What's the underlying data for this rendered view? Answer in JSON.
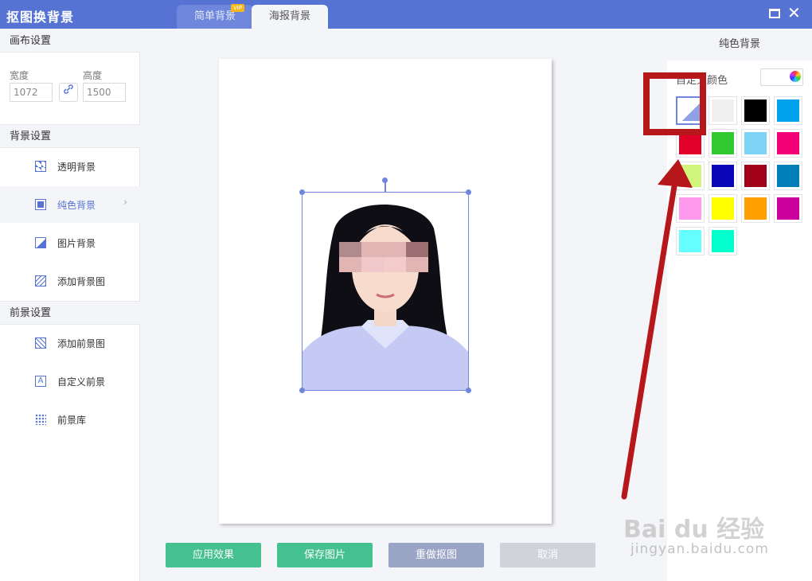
{
  "app": {
    "title": "抠图换背景"
  },
  "tabs": {
    "simple": "简单背景",
    "vip": "VIP",
    "poster": "海报背景"
  },
  "left": {
    "canvas_section": "画布设置",
    "width_label": "宽度",
    "width_value": "1072",
    "height_label": "高度",
    "height_value": "1500",
    "bg_section": "背景设置",
    "bg_items": [
      "透明背景",
      "纯色背景",
      "图片背景",
      "添加背景图"
    ],
    "fg_section": "前景设置",
    "fg_items": [
      "添加前景图",
      "自定义前景",
      "前景库"
    ]
  },
  "buttons": {
    "apply": "应用效果",
    "save": "保存图片",
    "redo": "重做抠图",
    "cancel": "取消"
  },
  "right": {
    "title": "纯色背景",
    "custom_color": "自定义颜色",
    "swatches": [
      "#ffffff",
      "#f0f0f0",
      "#000000",
      "#00a2ec",
      "#e0002a",
      "#31c830",
      "#7cd3f6",
      "#f00074",
      "#d2f67d",
      "#0a05b6",
      "#a10019",
      "#007eb8",
      "#ff99ec",
      "#ffff00",
      "#ff9f00",
      "#cc009c",
      "#66ffff",
      "#00ffcc"
    ],
    "selected_swatch": 0
  },
  "colors": {
    "accent": "#5673d4",
    "apply": "#44c18e",
    "redo": "#9aa5c6",
    "cancel": "#d1d3da",
    "annotation": "#b5171a"
  },
  "watermark": {
    "brand": "Bai du 经验",
    "url": "jingyan.baidu.com"
  }
}
